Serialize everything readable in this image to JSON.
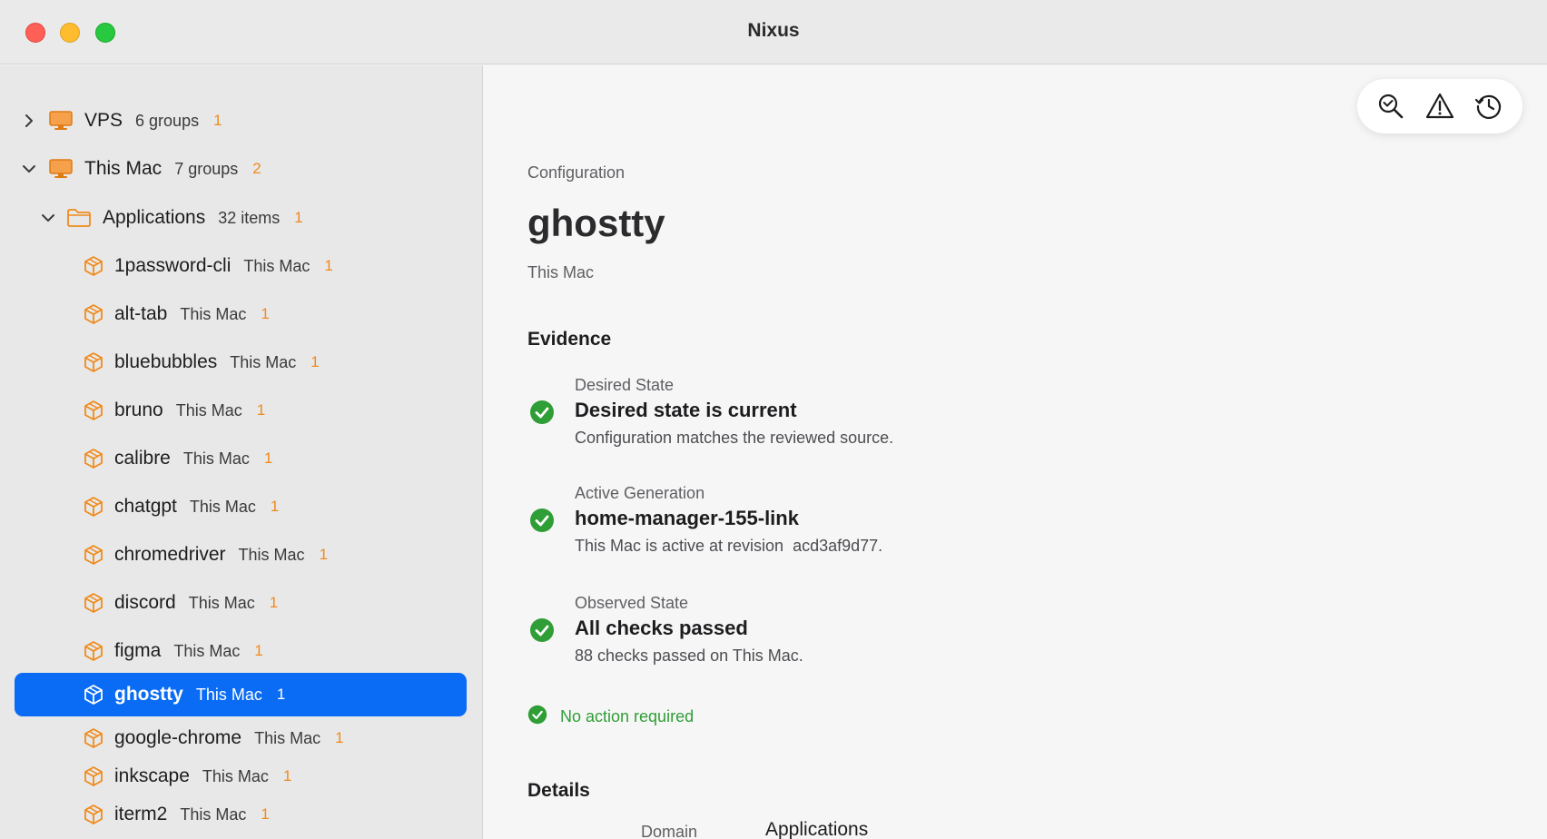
{
  "window": {
    "title": "Nixus"
  },
  "sidebar": {
    "groups": [
      {
        "name": "VPS",
        "sub": "6 groups",
        "badge": "1",
        "expanded": false,
        "icon": "desktop-icon"
      },
      {
        "name": "This Mac",
        "sub": "7 groups",
        "badge": "2",
        "expanded": true,
        "icon": "desktop-icon"
      }
    ],
    "folder": {
      "name": "Applications",
      "sub": "32 items",
      "badge": "1",
      "expanded": true,
      "icon": "folder-icon"
    },
    "items": [
      {
        "name": "1password-cli",
        "host": "This Mac",
        "badge": "1"
      },
      {
        "name": "alt-tab",
        "host": "This Mac",
        "badge": "1"
      },
      {
        "name": "bluebubbles",
        "host": "This Mac",
        "badge": "1"
      },
      {
        "name": "bruno",
        "host": "This Mac",
        "badge": "1"
      },
      {
        "name": "calibre",
        "host": "This Mac",
        "badge": "1"
      },
      {
        "name": "chatgpt",
        "host": "This Mac",
        "badge": "1"
      },
      {
        "name": "chromedriver",
        "host": "This Mac",
        "badge": "1"
      },
      {
        "name": "discord",
        "host": "This Mac",
        "badge": "1"
      },
      {
        "name": "figma",
        "host": "This Mac",
        "badge": "1"
      },
      {
        "name": "ghostty",
        "host": "This Mac",
        "badge": "1",
        "selected": true
      },
      {
        "name": "google-chrome",
        "host": "This Mac",
        "badge": "1"
      },
      {
        "name": "inkscape",
        "host": "This Mac",
        "badge": "1"
      },
      {
        "name": "iterm2",
        "host": "This Mac",
        "badge": "1"
      }
    ]
  },
  "toolbar": {
    "buttons": [
      "zoom-search-icon",
      "warning-triangle-icon",
      "history-icon"
    ]
  },
  "main": {
    "breadcrumb": "Configuration",
    "title": "ghostty",
    "subtitle": "This Mac",
    "evidence_heading": "Evidence",
    "evidence": [
      {
        "label": "Desired State",
        "headline": "Desired state is current",
        "desc": "Configuration matches the reviewed source."
      },
      {
        "label": "Active Generation",
        "headline": "home-manager-155-link",
        "desc": "This Mac is active at revision  acd3af9d77."
      },
      {
        "label": "Observed State",
        "headline": "All checks passed",
        "desc": "88 checks passed on This Mac."
      }
    ],
    "status": "No action required",
    "details_heading": "Details",
    "details": {
      "key": "Domain",
      "value": "Applications"
    }
  },
  "colors": {
    "accent": "#0a6cf4",
    "badge": "#f08a1c",
    "success": "#2f9e36",
    "icon_orange": "#f08a1c"
  }
}
